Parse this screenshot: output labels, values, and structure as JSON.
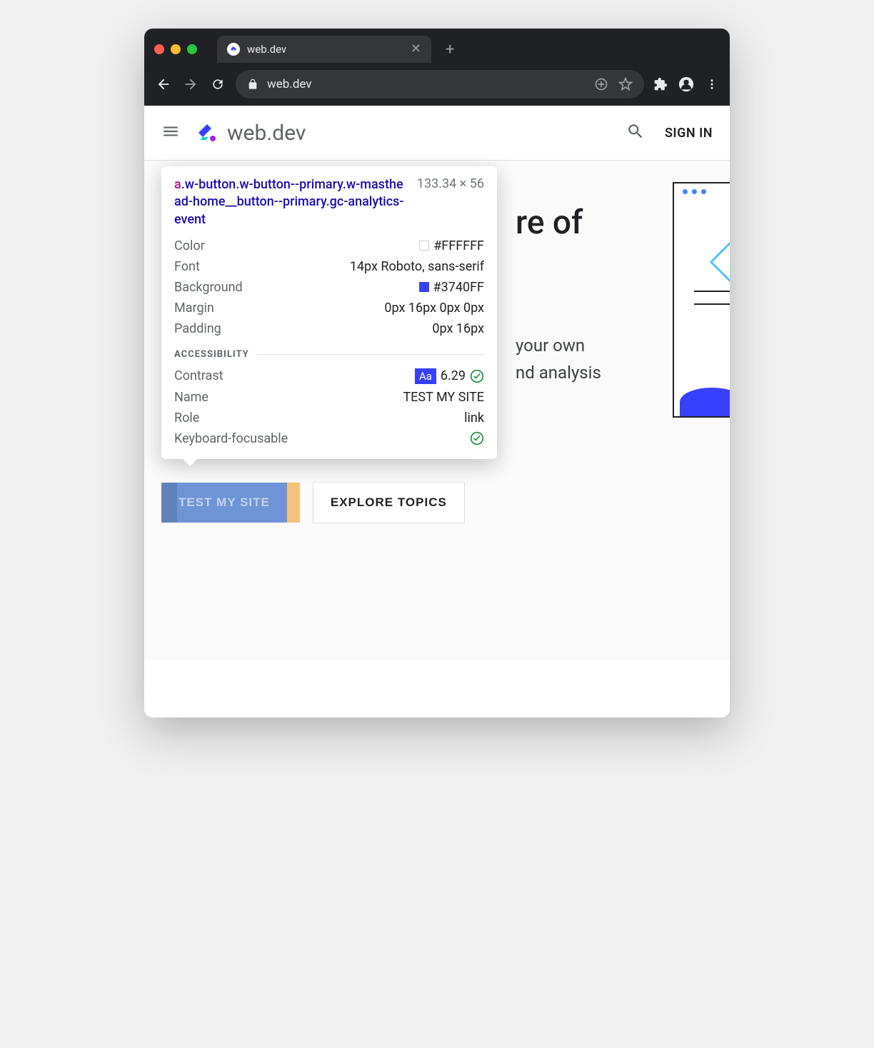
{
  "browser": {
    "tab_title": "web.dev",
    "url": "web.dev"
  },
  "header": {
    "logo_text": "web.dev",
    "sign_in": "SIGN IN"
  },
  "hero": {
    "title_fragment": "re of",
    "sub_line1": "your own",
    "sub_line2": "nd analysis"
  },
  "buttons": {
    "primary": "TEST MY SITE",
    "secondary": "EXPLORE TOPICS"
  },
  "tooltip": {
    "selector_tag": "a",
    "selector_rest": ".w-button.w-button--primary.w-masthead-home__button--primary.gc-analytics-event",
    "dimensions": "133.34 × 56",
    "styles": {
      "color_label": "Color",
      "color_value": "#FFFFFF",
      "font_label": "Font",
      "font_value": "14px Roboto, sans-serif",
      "background_label": "Background",
      "background_value": "#3740FF",
      "margin_label": "Margin",
      "margin_value": "0px 16px 0px 0px",
      "padding_label": "Padding",
      "padding_value": "0px 16px"
    },
    "accessibility_section": "ACCESSIBILITY",
    "a11y": {
      "contrast_label": "Contrast",
      "contrast_value": "6.29",
      "aa_badge": "Aa",
      "name_label": "Name",
      "name_value": "TEST MY SITE",
      "role_label": "Role",
      "role_value": "link",
      "focusable_label": "Keyboard-focusable"
    }
  }
}
